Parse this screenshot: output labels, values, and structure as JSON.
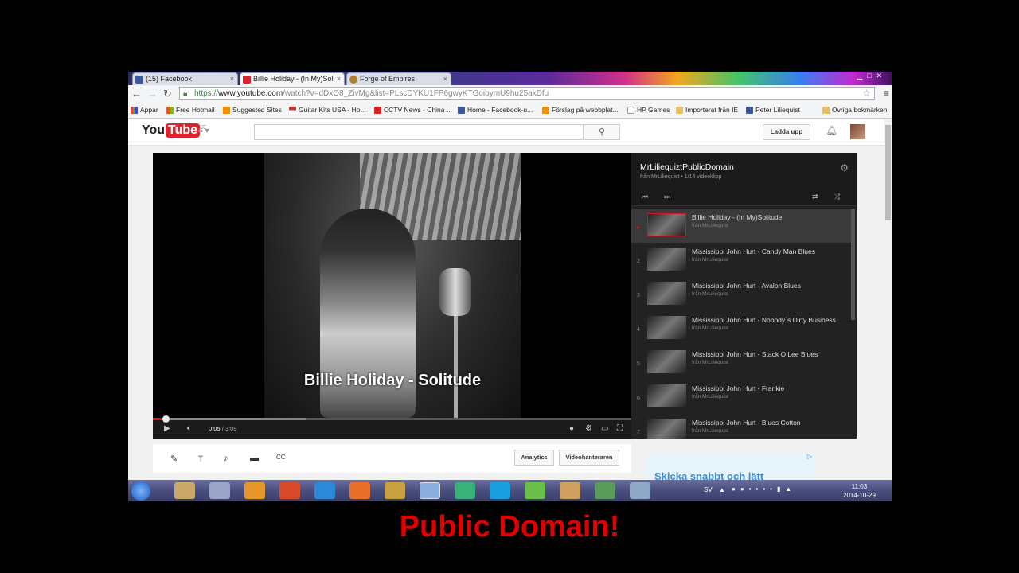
{
  "tabs": [
    {
      "label": "(15) Facebook"
    },
    {
      "label": "Billie Holiday - (In My)Soli"
    },
    {
      "label": "Forge of Empires"
    }
  ],
  "nav": {
    "url_scheme": "https://",
    "url_host": "www.youtube.com",
    "url_rest": "/watch?v=dDxO8_ZivMg&list=PLscDYKU1FP6gwyKTGoibymU9hu25akDfu"
  },
  "bookmarks": [
    {
      "label": "Appar"
    },
    {
      "label": "Free Hotmail"
    },
    {
      "label": "Suggested Sites"
    },
    {
      "label": "Guitar Kits USA - Ho..."
    },
    {
      "label": "CCTV News - China ..."
    },
    {
      "label": "Home - Facebook-u..."
    },
    {
      "label": "Förslag på webbplat..."
    },
    {
      "label": "HP Games"
    },
    {
      "label": "Importerat från IE"
    },
    {
      "label": "Peter Liliequist"
    },
    {
      "label": "Övriga bokmärken"
    }
  ],
  "youtube": {
    "logo_you": "You",
    "logo_tube": "Tube",
    "logo_region": "SE",
    "upload_label": "Ladda upp"
  },
  "player": {
    "caption": "Billie Holiday - Solitude",
    "time_current": "0:05",
    "time_total": "3:09",
    "progress_fraction": 0.026,
    "buffer_fraction": 0.32
  },
  "playlist": {
    "title": "MrLiliequiztPublicDomain",
    "subtitle": "från MrLiliequist • 1/14 videoklipp",
    "items": [
      {
        "index": "▸",
        "title": "Billie Holiday - (In My)Solitude",
        "by": "från MrLiliequist"
      },
      {
        "index": "2",
        "title": "Mississippi John Hurt - Candy Man Blues",
        "by": "från MrLiliequist"
      },
      {
        "index": "3",
        "title": "Mississippi John Hurt - Avalon Blues",
        "by": "från MrLiliequist"
      },
      {
        "index": "4",
        "title": "Mississippi John Hurt - Nobody´s Dirty Business",
        "by": "från MrLiliequist"
      },
      {
        "index": "5",
        "title": "Mississippi John Hurt - Stack O Lee Blues",
        "by": "från MrLiliequist"
      },
      {
        "index": "6",
        "title": "Mississippi John Hurt - Frankie",
        "by": "från MrLiliequist"
      },
      {
        "index": "7",
        "title": "Mississippi John Hurt - Blues Cotton",
        "by": "från MrLiliequist"
      }
    ]
  },
  "actions": {
    "analytics_label": "Analytics",
    "video_manager_label": "Videohanteraren"
  },
  "ad": {
    "text": "Skicka snabbt och lätt"
  },
  "taskbar": {
    "language": "SV",
    "time": "11:03",
    "date": "2014-10-29"
  },
  "footer": {
    "text": "Public Domain!"
  },
  "colors": {
    "youtube_red": "#cc181e",
    "footer_red": "#e10000"
  }
}
